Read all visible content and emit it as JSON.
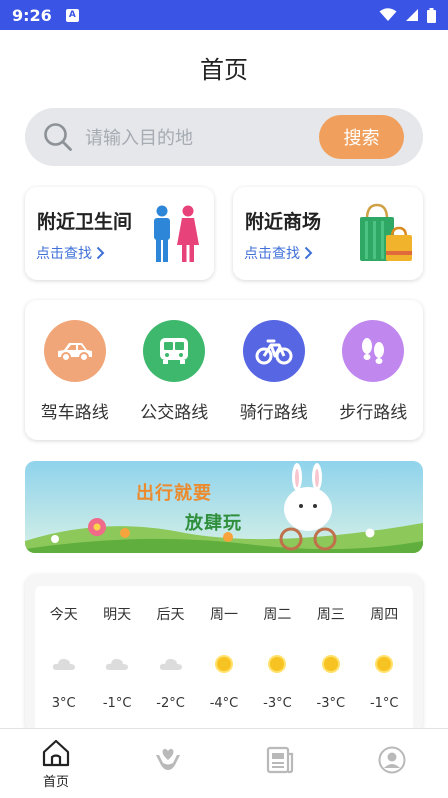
{
  "status_bar": {
    "time": "9:26",
    "notification_icon": "a-notification-icon"
  },
  "header": {
    "title": "首页"
  },
  "search": {
    "placeholder": "请输入目的地",
    "button_label": "搜索"
  },
  "nearby": [
    {
      "title": "附近卫生间",
      "link": "点击查找",
      "icon": "restroom-icon"
    },
    {
      "title": "附近商场",
      "link": "点击查找",
      "icon": "shopping-bags-icon"
    }
  ],
  "routes": [
    {
      "label": "驾车路线",
      "icon": "car-icon",
      "color": "#f0a678"
    },
    {
      "label": "公交路线",
      "icon": "bus-icon",
      "color": "#3db86d"
    },
    {
      "label": "骑行路线",
      "icon": "bicycle-icon",
      "color": "#5766e3"
    },
    {
      "label": "步行路线",
      "icon": "footprints-icon",
      "color": "#c087ef"
    }
  ],
  "banner": {
    "line1": "出行就要",
    "line2": "放肆玩"
  },
  "weather": [
    {
      "day": "今天",
      "icon": "cloudy-icon",
      "temp": "3°C"
    },
    {
      "day": "明天",
      "icon": "cloudy-icon",
      "temp": "-1°C"
    },
    {
      "day": "后天",
      "icon": "cloudy-icon",
      "temp": "-2°C"
    },
    {
      "day": "周一",
      "icon": "sunny-icon",
      "temp": "-4°C"
    },
    {
      "day": "周二",
      "icon": "sunny-icon",
      "temp": "-3°C"
    },
    {
      "day": "周三",
      "icon": "sunny-icon",
      "temp": "-3°C"
    },
    {
      "day": "周四",
      "icon": "sunny-icon",
      "temp": "-1°C"
    }
  ],
  "tabs": [
    {
      "label": "首页",
      "icon": "home-icon",
      "active": true
    },
    {
      "label": "",
      "icon": "heart-hands-icon",
      "active": false
    },
    {
      "label": "",
      "icon": "news-icon",
      "active": false
    },
    {
      "label": "",
      "icon": "user-profile-icon",
      "active": false
    }
  ],
  "colors": {
    "status_bar": "#3a55e6",
    "accent": "#f0a05c",
    "link": "#3f71d8"
  }
}
